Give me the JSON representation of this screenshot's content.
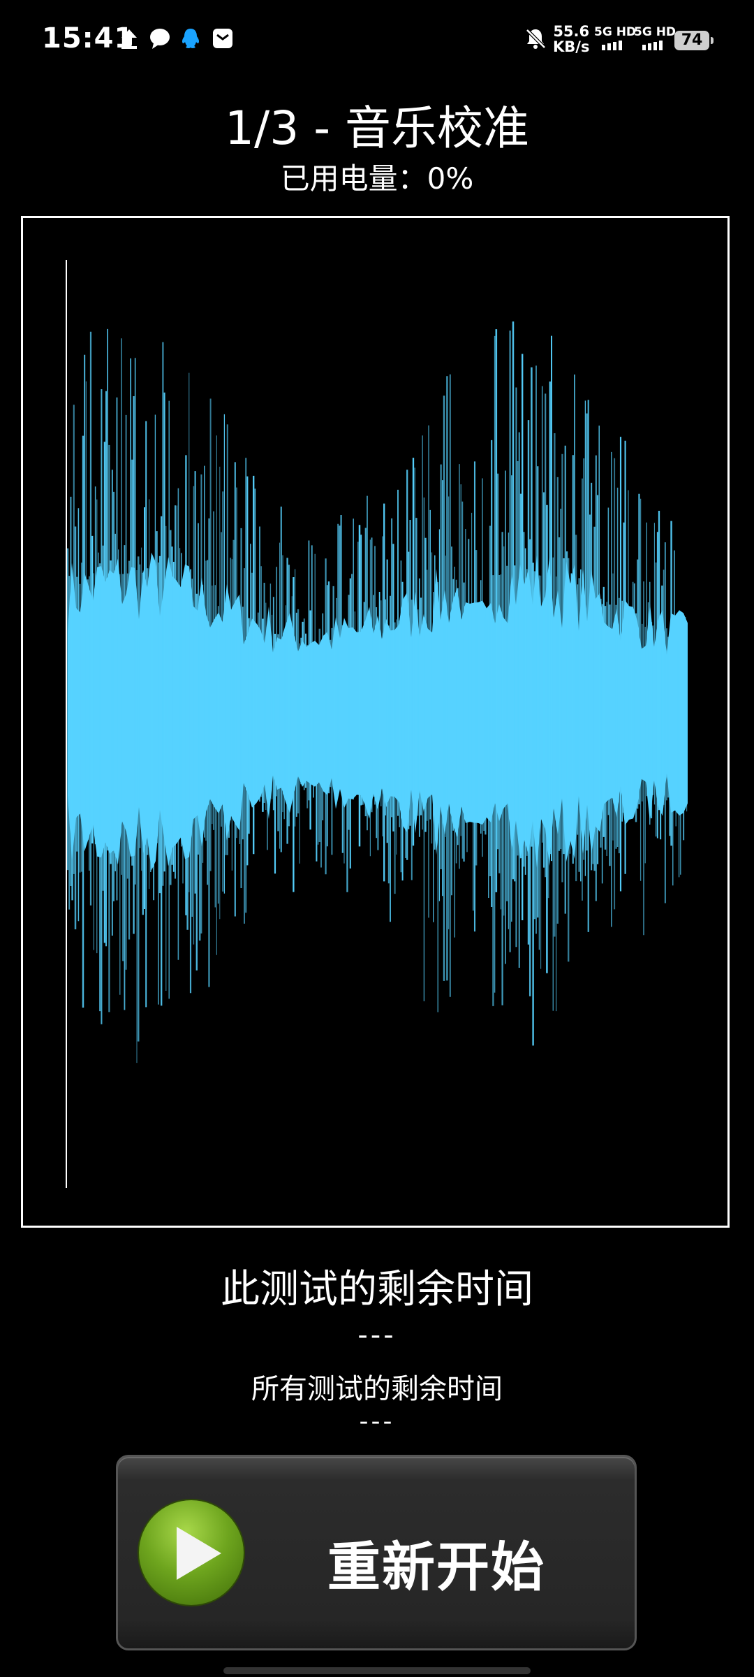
{
  "status_bar": {
    "time": "15:41",
    "net_speed_value": "55.6",
    "net_speed_unit": "KB/s",
    "sim1_label": "5G HD",
    "sim2_label": "5G HD",
    "battery": "74",
    "icons": [
      "upload-icon",
      "chat-bubble-icon",
      "qq-penguin-icon",
      "mail-icon",
      "bell-muted-icon"
    ]
  },
  "header": {
    "title": "1/3 - 音乐校准",
    "battery_used": "已用电量：0%"
  },
  "waveform": {
    "color": "#56d2ff",
    "progress": 0.0
  },
  "timers": {
    "this_test_label": "此测试的剩余时间",
    "this_test_value": "---",
    "all_tests_label": "所有测试的剩余时间",
    "all_tests_value": "---"
  },
  "restart_button": {
    "label": "重新开始",
    "icon": "play-icon"
  }
}
